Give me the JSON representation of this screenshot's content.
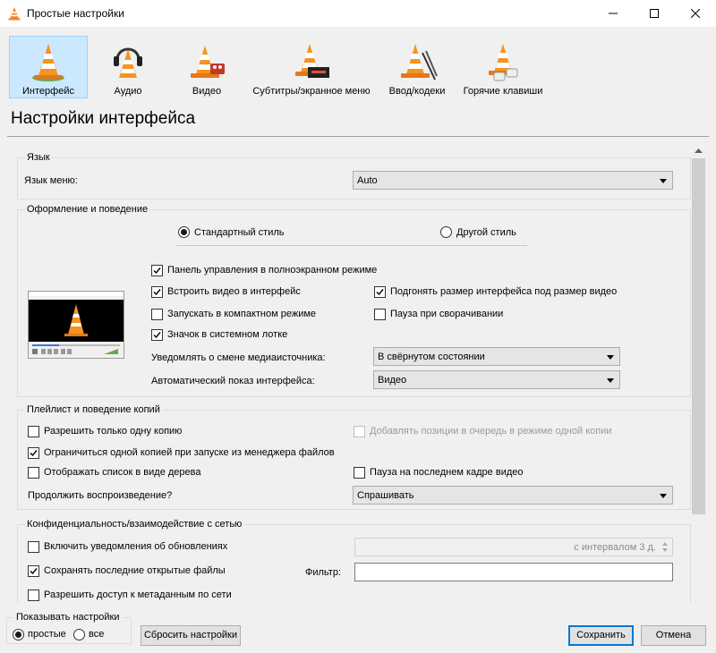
{
  "window": {
    "title": "Простые настройки"
  },
  "categories": [
    {
      "label": "Интерфейс",
      "icon": "vlc-interface-icon",
      "selected": true
    },
    {
      "label": "Аудио",
      "icon": "vlc-audio-icon"
    },
    {
      "label": "Видео",
      "icon": "vlc-video-icon"
    },
    {
      "label": "Субтитры/экранное меню",
      "icon": "vlc-subtitles-icon"
    },
    {
      "label": "Ввод/кодеки",
      "icon": "vlc-input-codecs-icon"
    },
    {
      "label": "Горячие клавиши",
      "icon": "vlc-hotkeys-icon"
    }
  ],
  "page_title": "Настройки интерфейса",
  "language": {
    "group_title": "Язык",
    "menu_language_label": "Язык меню:",
    "menu_language_value": "Auto"
  },
  "look": {
    "group_title": "Оформление и поведение",
    "style_native": "Стандартный стиль",
    "style_custom": "Другой стиль",
    "fullscreen_controls": "Панель управления в полноэкранном режиме",
    "embed_video": "Встроить видео в интерфейс",
    "resize_interface": "Подгонять размер интерфейса под размер видео",
    "compact_mode": "Запускать в компактном режиме",
    "pause_minimized": "Пауза при сворачивании",
    "systray_icon": "Значок в системном лотке",
    "notify_label": "Уведомлять о смене медиаисточника:",
    "notify_value": "В свёрнутом состоянии",
    "autoraise_label": "Автоматический показ интерфейса:",
    "autoraise_value": "Видео",
    "preview_title": "VLC media player"
  },
  "playlist": {
    "group_title": "Плейлист и поведение копий",
    "one_instance": "Разрешить только одну копию",
    "enqueue_one_instance": "Добавлять позиции в очередь в режиме одной копии",
    "one_instance_file_manager": "Ограничиться одной копией при запуске из менеджера файлов",
    "tree_view": "Отображать список в виде дерева",
    "pause_last_frame": "Пауза на последнем кадре видео",
    "continue_label": "Продолжить воспроизведение?",
    "continue_value": "Спрашивать"
  },
  "privacy": {
    "group_title": "Конфиденциальность/взаимодействие с сетью",
    "update_notify": "Включить уведомления об обновлениях",
    "update_interval": "с интервалом 3 д.",
    "save_recent": "Сохранять последние открытые файлы",
    "filter_label": "Фильтр:",
    "filter_value": "",
    "metadata_access": "Разрешить доступ к метаданным по сети"
  },
  "footer": {
    "show_settings_title": "Показывать настройки",
    "simple": "простые",
    "all": "все",
    "reset_button": "Сбросить настройки",
    "save_button": "Сохранить",
    "cancel_button": "Отмена"
  }
}
